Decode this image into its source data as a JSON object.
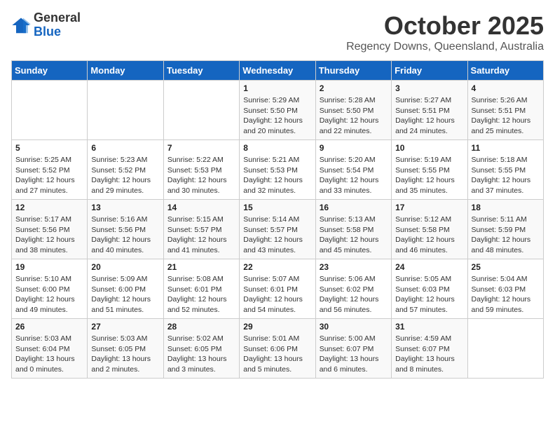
{
  "header": {
    "logo_general": "General",
    "logo_blue": "Blue",
    "month": "October 2025",
    "location": "Regency Downs, Queensland, Australia"
  },
  "weekdays": [
    "Sunday",
    "Monday",
    "Tuesday",
    "Wednesday",
    "Thursday",
    "Friday",
    "Saturday"
  ],
  "weeks": [
    [
      {
        "day": "",
        "info": ""
      },
      {
        "day": "",
        "info": ""
      },
      {
        "day": "",
        "info": ""
      },
      {
        "day": "1",
        "info": "Sunrise: 5:29 AM\nSunset: 5:50 PM\nDaylight: 12 hours\nand 20 minutes."
      },
      {
        "day": "2",
        "info": "Sunrise: 5:28 AM\nSunset: 5:50 PM\nDaylight: 12 hours\nand 22 minutes."
      },
      {
        "day": "3",
        "info": "Sunrise: 5:27 AM\nSunset: 5:51 PM\nDaylight: 12 hours\nand 24 minutes."
      },
      {
        "day": "4",
        "info": "Sunrise: 5:26 AM\nSunset: 5:51 PM\nDaylight: 12 hours\nand 25 minutes."
      }
    ],
    [
      {
        "day": "5",
        "info": "Sunrise: 5:25 AM\nSunset: 5:52 PM\nDaylight: 12 hours\nand 27 minutes."
      },
      {
        "day": "6",
        "info": "Sunrise: 5:23 AM\nSunset: 5:52 PM\nDaylight: 12 hours\nand 29 minutes."
      },
      {
        "day": "7",
        "info": "Sunrise: 5:22 AM\nSunset: 5:53 PM\nDaylight: 12 hours\nand 30 minutes."
      },
      {
        "day": "8",
        "info": "Sunrise: 5:21 AM\nSunset: 5:53 PM\nDaylight: 12 hours\nand 32 minutes."
      },
      {
        "day": "9",
        "info": "Sunrise: 5:20 AM\nSunset: 5:54 PM\nDaylight: 12 hours\nand 33 minutes."
      },
      {
        "day": "10",
        "info": "Sunrise: 5:19 AM\nSunset: 5:55 PM\nDaylight: 12 hours\nand 35 minutes."
      },
      {
        "day": "11",
        "info": "Sunrise: 5:18 AM\nSunset: 5:55 PM\nDaylight: 12 hours\nand 37 minutes."
      }
    ],
    [
      {
        "day": "12",
        "info": "Sunrise: 5:17 AM\nSunset: 5:56 PM\nDaylight: 12 hours\nand 38 minutes."
      },
      {
        "day": "13",
        "info": "Sunrise: 5:16 AM\nSunset: 5:56 PM\nDaylight: 12 hours\nand 40 minutes."
      },
      {
        "day": "14",
        "info": "Sunrise: 5:15 AM\nSunset: 5:57 PM\nDaylight: 12 hours\nand 41 minutes."
      },
      {
        "day": "15",
        "info": "Sunrise: 5:14 AM\nSunset: 5:57 PM\nDaylight: 12 hours\nand 43 minutes."
      },
      {
        "day": "16",
        "info": "Sunrise: 5:13 AM\nSunset: 5:58 PM\nDaylight: 12 hours\nand 45 minutes."
      },
      {
        "day": "17",
        "info": "Sunrise: 5:12 AM\nSunset: 5:58 PM\nDaylight: 12 hours\nand 46 minutes."
      },
      {
        "day": "18",
        "info": "Sunrise: 5:11 AM\nSunset: 5:59 PM\nDaylight: 12 hours\nand 48 minutes."
      }
    ],
    [
      {
        "day": "19",
        "info": "Sunrise: 5:10 AM\nSunset: 6:00 PM\nDaylight: 12 hours\nand 49 minutes."
      },
      {
        "day": "20",
        "info": "Sunrise: 5:09 AM\nSunset: 6:00 PM\nDaylight: 12 hours\nand 51 minutes."
      },
      {
        "day": "21",
        "info": "Sunrise: 5:08 AM\nSunset: 6:01 PM\nDaylight: 12 hours\nand 52 minutes."
      },
      {
        "day": "22",
        "info": "Sunrise: 5:07 AM\nSunset: 6:01 PM\nDaylight: 12 hours\nand 54 minutes."
      },
      {
        "day": "23",
        "info": "Sunrise: 5:06 AM\nSunset: 6:02 PM\nDaylight: 12 hours\nand 56 minutes."
      },
      {
        "day": "24",
        "info": "Sunrise: 5:05 AM\nSunset: 6:03 PM\nDaylight: 12 hours\nand 57 minutes."
      },
      {
        "day": "25",
        "info": "Sunrise: 5:04 AM\nSunset: 6:03 PM\nDaylight: 12 hours\nand 59 minutes."
      }
    ],
    [
      {
        "day": "26",
        "info": "Sunrise: 5:03 AM\nSunset: 6:04 PM\nDaylight: 13 hours\nand 0 minutes."
      },
      {
        "day": "27",
        "info": "Sunrise: 5:03 AM\nSunset: 6:05 PM\nDaylight: 13 hours\nand 2 minutes."
      },
      {
        "day": "28",
        "info": "Sunrise: 5:02 AM\nSunset: 6:05 PM\nDaylight: 13 hours\nand 3 minutes."
      },
      {
        "day": "29",
        "info": "Sunrise: 5:01 AM\nSunset: 6:06 PM\nDaylight: 13 hours\nand 5 minutes."
      },
      {
        "day": "30",
        "info": "Sunrise: 5:00 AM\nSunset: 6:07 PM\nDaylight: 13 hours\nand 6 minutes."
      },
      {
        "day": "31",
        "info": "Sunrise: 4:59 AM\nSunset: 6:07 PM\nDaylight: 13 hours\nand 8 minutes."
      },
      {
        "day": "",
        "info": ""
      }
    ]
  ]
}
